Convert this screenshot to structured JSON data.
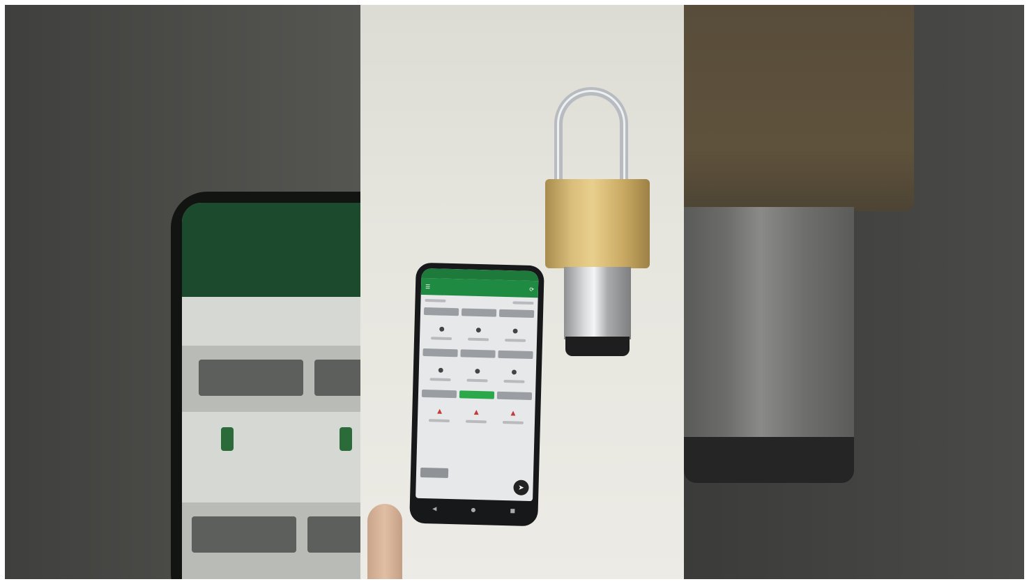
{
  "scene": {
    "description_layers": [
      "left-blurred-phone",
      "center-photo",
      "right-blurred-lock"
    ]
  },
  "phone_app": {
    "icons": {
      "menu": "menu-icon",
      "refresh": "refresh-icon",
      "fab": "fab-icon"
    },
    "colors": {
      "status_bar": "#1d7a3b",
      "app_bar": "#1f8a41",
      "active_button": "#2aa84a"
    },
    "grid_rows": [
      {
        "buttons": [
          "",
          "",
          ""
        ],
        "active_index": -1
      },
      {
        "buttons": [
          "",
          "",
          ""
        ],
        "active_index": -1
      },
      {
        "buttons": [
          "",
          "",
          ""
        ],
        "active_index": 1
      }
    ]
  }
}
